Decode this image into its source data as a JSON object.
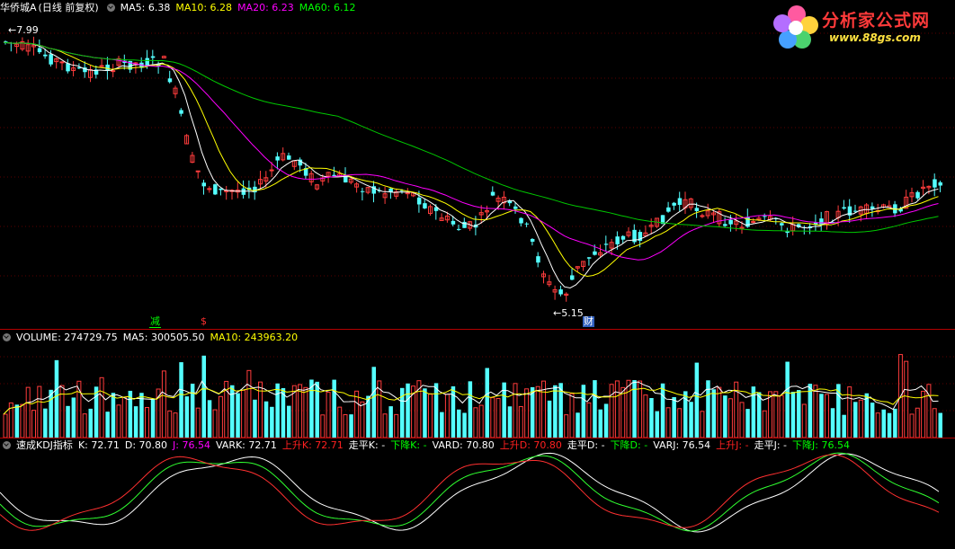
{
  "app": {
    "stock_name": "华侨城A",
    "period": "(日线 前复权)"
  },
  "logo": {
    "title": "分析家公式网",
    "url": "www.88gs.com"
  },
  "main_pane": {
    "ma": [
      {
        "label": "MA5: 6.38",
        "color": "#ffffff"
      },
      {
        "label": "MA10: 6.28",
        "color": "#ffff00"
      },
      {
        "label": "MA20: 6.23",
        "color": "#ff00ff"
      },
      {
        "label": "MA60: 6.12",
        "color": "#00ff00"
      }
    ],
    "high_label": "7.99",
    "low_label": "5.15",
    "markers": [
      {
        "text": "减",
        "color": "#00ff00"
      },
      {
        "text": "$",
        "color": "#ff3030"
      },
      {
        "text": "财",
        "color": "#ffffff"
      }
    ]
  },
  "volume_pane": {
    "label": "VOLUME: 274729.75",
    "ma5": "MA5: 300505.50",
    "ma10": "MA10: 243963.20"
  },
  "kdj_pane": {
    "title": "速成KDJ指标",
    "items": [
      {
        "text": "K: 72.71",
        "color": "#ffffff"
      },
      {
        "text": "D: 70.80",
        "color": "#ffffff"
      },
      {
        "text": "J: 76.54",
        "color": "#ff00ff"
      },
      {
        "text": "VARK: 72.71",
        "color": "#ffffff"
      },
      {
        "text": "上升K: 72.71",
        "color": "#ff2020"
      },
      {
        "text": "走平K: -",
        "color": "#ffffff"
      },
      {
        "text": "下降K: -",
        "color": "#00ff00"
      },
      {
        "text": "VARD: 70.80",
        "color": "#ffffff"
      },
      {
        "text": "上升D: 70.80",
        "color": "#ff2020"
      },
      {
        "text": "走平D: -",
        "color": "#ffffff"
      },
      {
        "text": "下降D: -",
        "color": "#00ff00"
      },
      {
        "text": "VARJ: 76.54",
        "color": "#ffffff"
      },
      {
        "text": "上升J: -",
        "color": "#ff2020"
      },
      {
        "text": "走平J: -",
        "color": "#ffffff"
      },
      {
        "text": "下降J: 76.54",
        "color": "#00ff00"
      }
    ]
  },
  "colors": {
    "up": "#ff3c3c",
    "down": "#54ffff",
    "grid": "#5a0000",
    "separator": "#b40000"
  }
}
